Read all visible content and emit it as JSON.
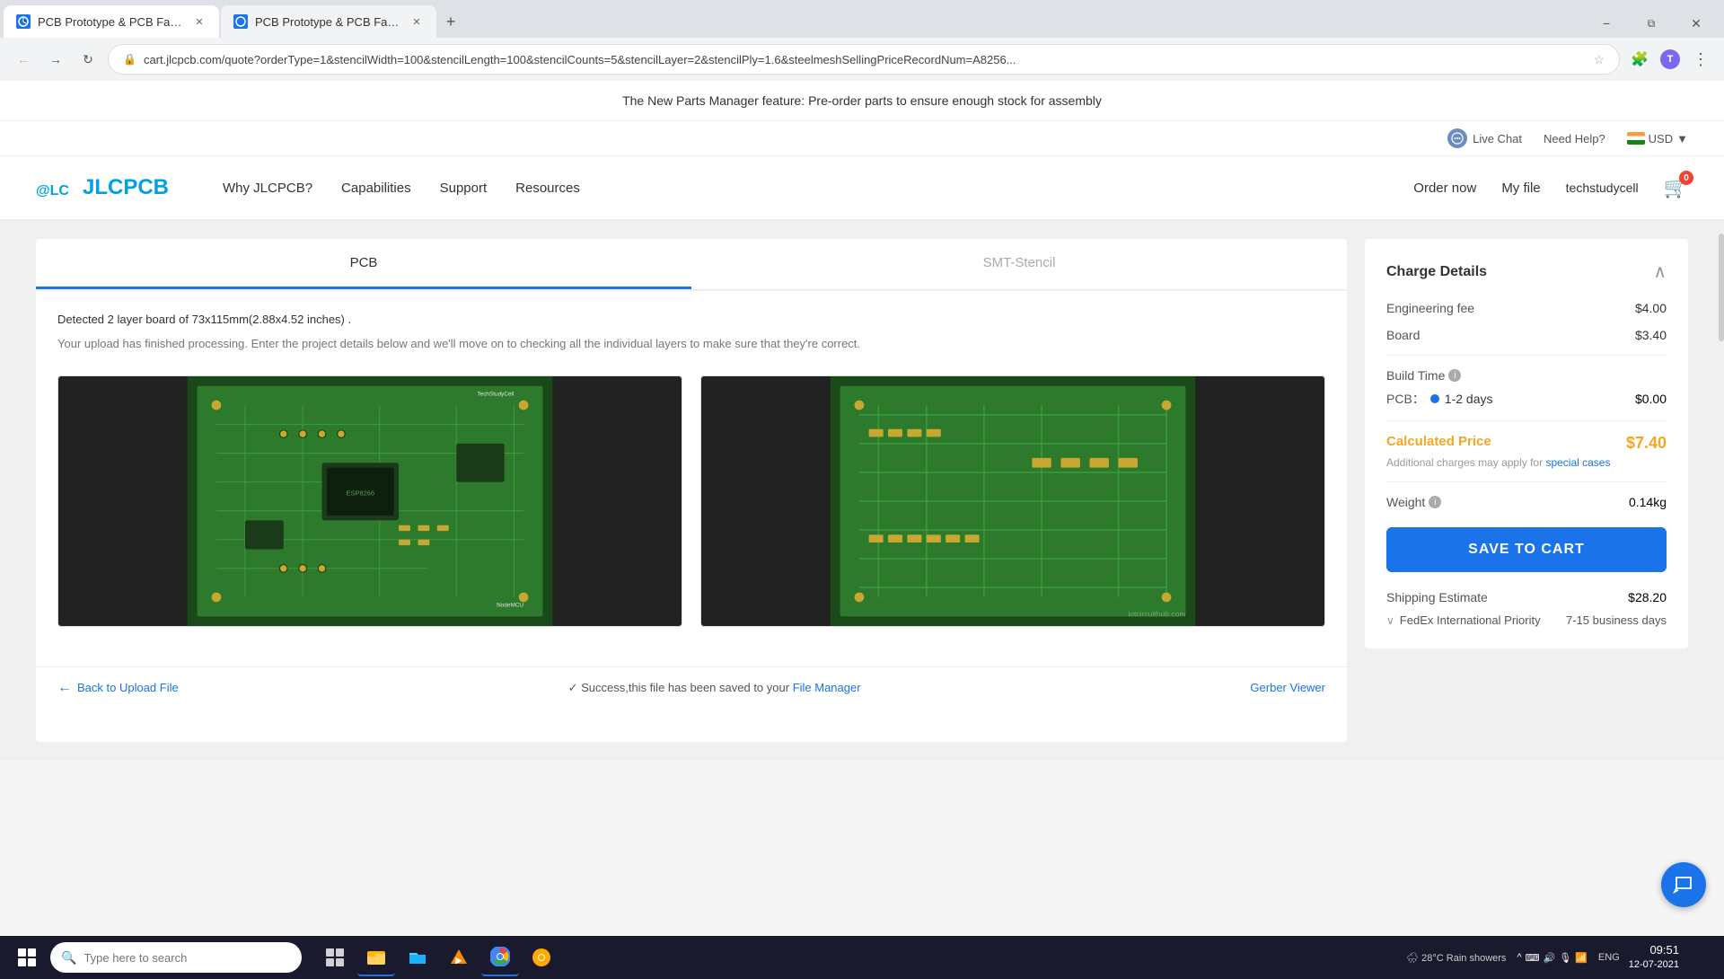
{
  "browser": {
    "tabs": [
      {
        "id": "tab1",
        "title": "PCB Prototype & PCB Fabricatio...",
        "favicon": "pcb",
        "active": true
      },
      {
        "id": "tab2",
        "title": "PCB Prototype & PCB Fabricatio...",
        "favicon": "pcb",
        "active": false
      }
    ],
    "url": "cart.jlcpcb.com/quote?orderType=1&stencilWidth=100&stencilLength=100&stencilCounts=5&stencilLayer=2&stencilPly=1.6&steelmeshSellingPriceRecordNum=A8256...",
    "toolbar_icons": [
      "star",
      "extensions",
      "profile"
    ]
  },
  "announcement": {
    "text": "The New Parts Manager feature: Pre-order parts to ensure enough stock for assembly"
  },
  "top_nav": {
    "live_chat_label": "Live Chat",
    "need_help_label": "Need Help?",
    "currency": "USD",
    "currency_icon": "▼"
  },
  "header": {
    "logo_text": "JLCPCB",
    "nav_items": [
      {
        "label": "Why JLCPCB?"
      },
      {
        "label": "Capabilities"
      },
      {
        "label": "Support"
      },
      {
        "label": "Resources"
      }
    ],
    "order_now": "Order now",
    "my_file": "My file",
    "username": "techstudycell",
    "cart_count": "0"
  },
  "quote_panel": {
    "tab_pcb": "PCB",
    "tab_smt": "SMT-Stencil",
    "detection_text": "Detected 2 layer board of 73x115mm(2.88x4.52 inches) .",
    "upload_message": "Your upload has finished processing. Enter the project details below and we'll move on to checking all the individual layers to make sure that they're correct.",
    "back_link": "Back to Upload File",
    "success_msg": "✓  Success,this file has been saved to your",
    "file_manager_link": "File Manager",
    "gerber_viewer": "Gerber Viewer"
  },
  "charge_details": {
    "title": "Charge Details",
    "engineering_fee_label": "Engineering fee",
    "engineering_fee_value": "$4.00",
    "board_label": "Board",
    "board_value": "$3.40",
    "build_time_label": "Build Time",
    "pcb_label": "PCB：",
    "build_time_days": "1-2 days",
    "build_time_price": "$0.00",
    "calculated_price_label": "Calculated Price",
    "calculated_price_value": "$7.40",
    "special_note": "Additional charges may apply for",
    "special_cases_link": "special cases",
    "weight_label": "Weight",
    "weight_value": "0.14kg",
    "save_to_cart": "SAVE TO CART",
    "shipping_label": "Shipping Estimate",
    "shipping_value": "$28.20",
    "fedex_label": "FedEx International Priority",
    "fedex_days": "7-15 business days"
  },
  "taskbar": {
    "search_placeholder": "Type here to search",
    "time": "09:51",
    "date": "12-07-2021",
    "language": "ENG",
    "weather": "28°C  Rain showers",
    "apps": [
      "windows-icon",
      "search-icon",
      "task-view-icon",
      "file-explorer-icon",
      "folder-icon",
      "vlc-icon",
      "chrome-icon",
      "chrome-canary-icon"
    ]
  }
}
